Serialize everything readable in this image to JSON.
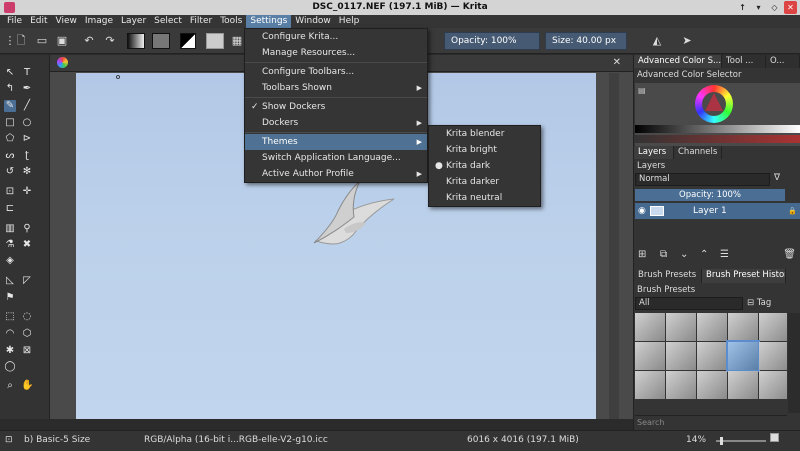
{
  "window": {
    "title": "DSC_0117.NEF (197.1 MiB) — Krita"
  },
  "menubar": [
    "File",
    "Edit",
    "View",
    "Image",
    "Layer",
    "Select",
    "Filter",
    "Tools",
    "Settings",
    "Window",
    "Help"
  ],
  "toolbar": {
    "opacity": "Opacity:  100%",
    "size_label": "Size:",
    "size_value": "40.00 px"
  },
  "settings_menu": {
    "items": [
      "Configure Krita...",
      "Manage Resources...",
      "Configure Toolbars...",
      "Toolbars Shown",
      "Show Dockers",
      "Dockers",
      "Themes",
      "Switch Application Language...",
      "Active Author Profile"
    ]
  },
  "themes_menu": {
    "items": [
      "Krita blender",
      "Krita bright",
      "Krita dark",
      "Krita darker",
      "Krita neutral"
    ],
    "selected": "Krita dark"
  },
  "dock": {
    "tabs1": [
      "Advanced Color S...",
      "Tool ...",
      "O..."
    ],
    "color_selector_title": "Advanced Color Selector",
    "tabs2": [
      "Layers",
      "Channels"
    ],
    "layers_title": "Layers",
    "blend_mode": "Normal",
    "opacity": "Opacity:  100%",
    "layer_name": "Layer 1",
    "tabs3": [
      "Brush Presets",
      "Brush Preset History"
    ],
    "brush_title": "Brush Presets",
    "brush_filter": "All",
    "brush_tag": "Tag",
    "search_placeholder": "Search"
  },
  "status": {
    "brush": "b) Basic-5 Size",
    "colorspace": "RGB/Alpha (16-bit i...RGB-elle-V2-g10.icc",
    "dimensions": "6016 x 4016 (197.1 MiB)",
    "zoom": "14%"
  },
  "colors": {
    "accent": "#4f7193",
    "sky": "#bcd0ea"
  }
}
